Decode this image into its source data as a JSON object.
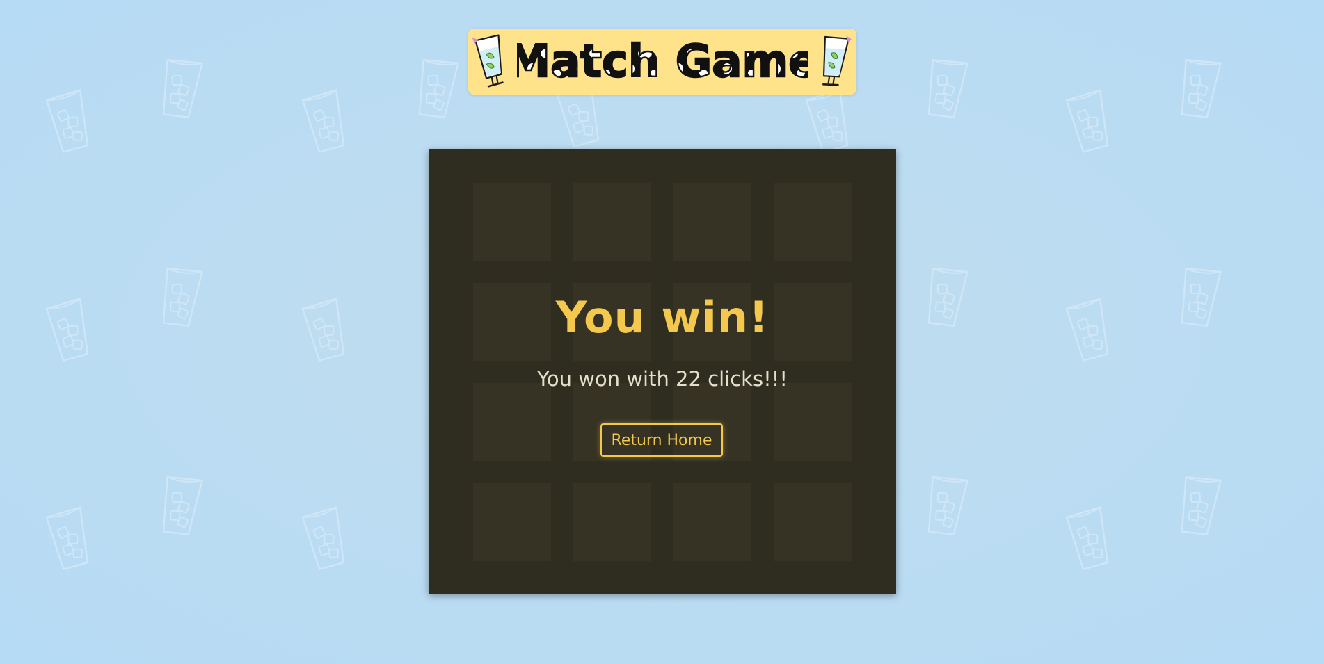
{
  "header": {
    "title": "Match Game",
    "decoration_icon": "iced-drink-glass-icon"
  },
  "background": {
    "pattern_icon": "glass-with-ice-icon",
    "color": "#b6dbf4"
  },
  "game": {
    "grid_rows": 4,
    "grid_columns": 4,
    "board_color": "#2e2d20",
    "card_color": "#363324"
  },
  "result": {
    "title": "You win!",
    "message": "You won with 22 clicks!!!",
    "return_button_label": "Return Home",
    "accent_color": "#f3c84d"
  }
}
